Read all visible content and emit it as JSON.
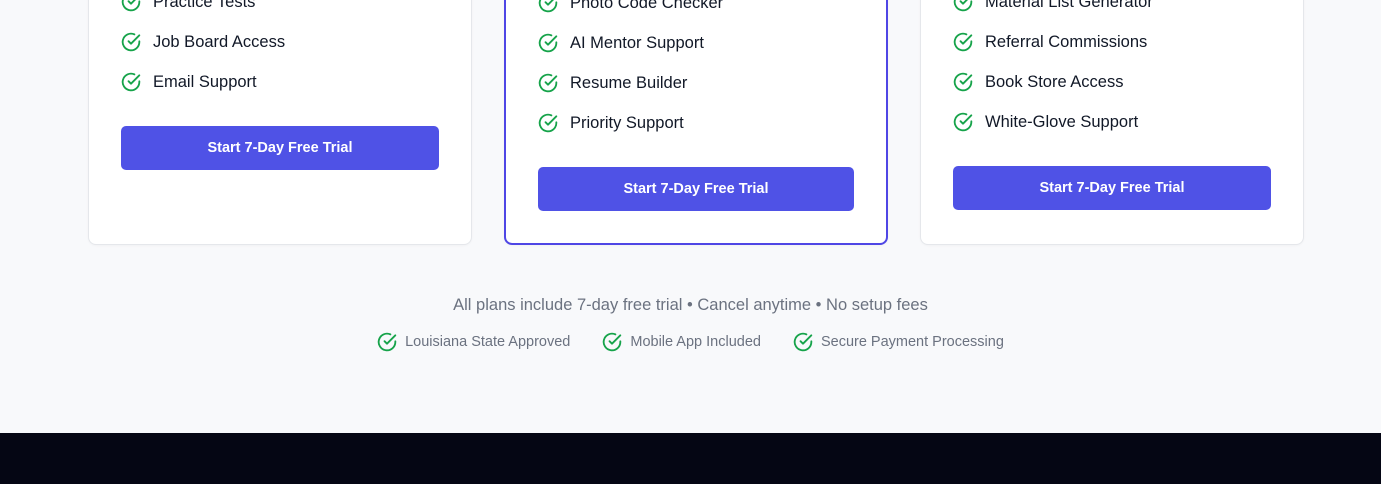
{
  "plans": {
    "left": {
      "features": [
        "Practice Tests",
        "Job Board Access",
        "Email Support"
      ],
      "cta_label": "Start 7-Day Free Trial"
    },
    "middle": {
      "features": [
        "Photo Code Checker",
        "AI Mentor Support",
        "Resume Builder",
        "Priority Support"
      ],
      "cta_label": "Start 7-Day Free Trial"
    },
    "right": {
      "features": [
        "Material List Generator",
        "Referral Commissions",
        "Book Store Access",
        "White-Glove Support"
      ],
      "cta_label": "Start 7-Day Free Trial"
    }
  },
  "footnote": "All plans include 7-day free trial • Cancel anytime • No setup fees",
  "badges": [
    "Louisiana State Approved",
    "Mobile App Included",
    "Secure Payment Processing"
  ],
  "icons": {
    "feature": "check-circle-icon"
  },
  "colors": {
    "accent": "#4f52e6",
    "check_green": "#16a34a",
    "footer_bg": "#050614"
  }
}
